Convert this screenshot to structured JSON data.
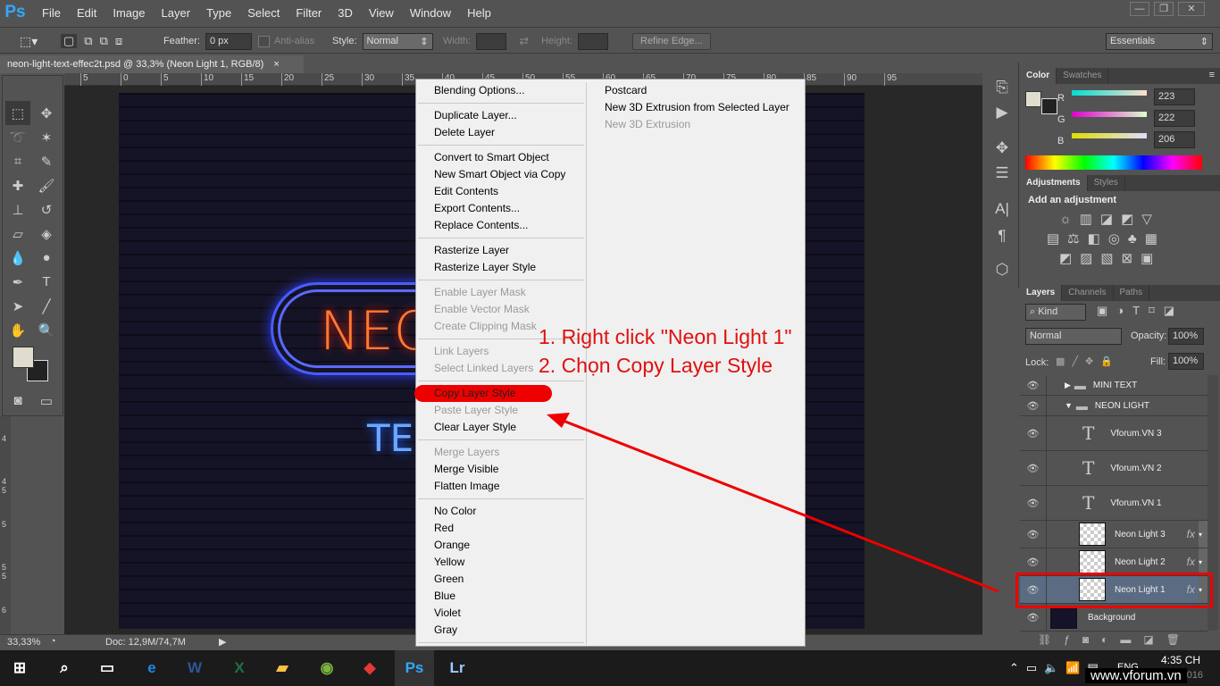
{
  "app": {
    "logo": "Ps",
    "menu": [
      "File",
      "Edit",
      "Image",
      "Layer",
      "Type",
      "Select",
      "Filter",
      "3D",
      "View",
      "Window",
      "Help"
    ],
    "window_controls": [
      "minimize",
      "restore",
      "close"
    ]
  },
  "options": {
    "feather_label": "Feather:",
    "feather_value": "0 px",
    "antialias_label": "Anti-alias",
    "style_label": "Style:",
    "style_value": "Normal",
    "width_label": "Width:",
    "height_label": "Height:",
    "refine_edge": "Refine Edge...",
    "workspace": "Essentials"
  },
  "document": {
    "tab_title": "neon-light-text-effec2t.psd @ 33,3% (Neon Light 1, RGB/8)",
    "close": "×",
    "canvas_text_main": "NEO",
    "canvas_text_sub": "TE"
  },
  "ruler": {
    "top": [
      "5",
      "0",
      "5",
      "10",
      "15",
      "20",
      "25",
      "30",
      "35",
      "40",
      "45",
      "50",
      "55",
      "60",
      "65",
      "70",
      "75",
      "80",
      "85",
      "90",
      "95"
    ],
    "left": [
      "4",
      "4 5",
      "5",
      "5 5",
      "6"
    ]
  },
  "status": {
    "zoom": "33,33%",
    "doc": "Doc: 12,9M/74,7M"
  },
  "context_menu": {
    "left": [
      [
        {
          "label": "Blending Options...",
          "enabled": true
        }
      ],
      [
        {
          "label": "Duplicate Layer...",
          "enabled": true
        },
        {
          "label": "Delete Layer",
          "enabled": true
        }
      ],
      [
        {
          "label": "Convert to Smart Object",
          "enabled": true
        },
        {
          "label": "New Smart Object via Copy",
          "enabled": true
        },
        {
          "label": "Edit Contents",
          "enabled": true
        },
        {
          "label": "Export Contents...",
          "enabled": true
        },
        {
          "label": "Replace Contents...",
          "enabled": true
        }
      ],
      [
        {
          "label": "Rasterize Layer",
          "enabled": true
        },
        {
          "label": "Rasterize Layer Style",
          "enabled": true
        }
      ],
      [
        {
          "label": "Enable Layer Mask",
          "enabled": false
        },
        {
          "label": "Enable Vector Mask",
          "enabled": false
        },
        {
          "label": "Create Clipping Mask",
          "enabled": false
        }
      ],
      [
        {
          "label": "Link Layers",
          "enabled": false
        },
        {
          "label": "Select Linked Layers",
          "enabled": false
        }
      ],
      [
        {
          "label": "Copy Layer Style",
          "enabled": true,
          "highlighted": true
        },
        {
          "label": "Paste Layer Style",
          "enabled": false
        },
        {
          "label": "Clear Layer Style",
          "enabled": true
        }
      ],
      [
        {
          "label": "Merge Layers",
          "enabled": false
        },
        {
          "label": "Merge Visible",
          "enabled": true
        },
        {
          "label": "Flatten Image",
          "enabled": true
        }
      ],
      [
        {
          "label": "No Color",
          "enabled": true
        },
        {
          "label": "Red",
          "enabled": true
        },
        {
          "label": "Orange",
          "enabled": true
        },
        {
          "label": "Yellow",
          "enabled": true
        },
        {
          "label": "Green",
          "enabled": true
        },
        {
          "label": "Blue",
          "enabled": true
        },
        {
          "label": "Violet",
          "enabled": true
        },
        {
          "label": "Gray",
          "enabled": true
        }
      ]
    ],
    "right": [
      {
        "label": "Postcard",
        "enabled": true
      },
      {
        "label": "New 3D Extrusion from Selected Layer",
        "enabled": true
      },
      {
        "label": "New 3D Extrusion",
        "enabled": false
      }
    ]
  },
  "annotation": {
    "line1": "1. Right click \"Neon Light 1\"",
    "line2": "2. Chọn Copy Layer Style",
    "color": "#e01010"
  },
  "color_panel": {
    "tabs": [
      "Color",
      "Swatches"
    ],
    "r_label": "R",
    "g_label": "G",
    "b_label": "B",
    "r": "223",
    "g": "222",
    "b": "206"
  },
  "adjustments": {
    "tabs": [
      "Adjustments",
      "Styles"
    ],
    "heading": "Add an adjustment"
  },
  "layers": {
    "tabs": [
      "Layers",
      "Channels",
      "Paths"
    ],
    "filter": "Kind",
    "blend_mode": "Normal",
    "opacity_label": "Opacity:",
    "opacity": "100%",
    "lock_label": "Lock:",
    "fill_label": "Fill:",
    "fill": "100%",
    "items": [
      {
        "name": "MINI TEXT",
        "type": "group",
        "collapsed": true
      },
      {
        "name": "NEON LIGHT",
        "type": "group",
        "collapsed": false
      },
      {
        "name": "Vforum.VN 3",
        "type": "text"
      },
      {
        "name": "Vforum.VN 2",
        "type": "text"
      },
      {
        "name": "Vforum.VN 1",
        "type": "text"
      },
      {
        "name": "Neon Light 3",
        "type": "smart",
        "fx": "fx"
      },
      {
        "name": "Neon Light 2",
        "type": "smart",
        "fx": "fx"
      },
      {
        "name": "Neon Light 1",
        "type": "smart",
        "fx": "fx",
        "selected": true
      },
      {
        "name": "Background",
        "type": "image"
      }
    ]
  },
  "taskbar": {
    "apps": [
      "Start",
      "Search",
      "Task View",
      "Edge",
      "Word",
      "Excel",
      "File Explorer",
      "Coc Coc",
      "Foxit",
      "Photoshop",
      "Lightroom"
    ],
    "lang": "ENG",
    "time": "4:35 CH",
    "date": "21/04/2016",
    "watermark": "www.vforum.vn"
  }
}
